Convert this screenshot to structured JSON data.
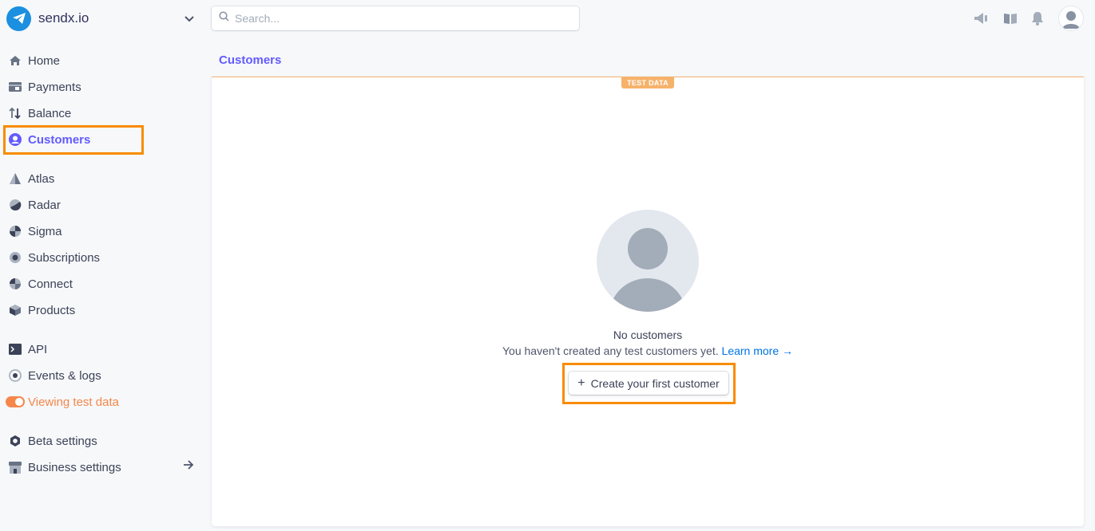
{
  "account": {
    "name": "sendx.io"
  },
  "search": {
    "placeholder": "Search..."
  },
  "sidebar": {
    "items": [
      {
        "label": "Home"
      },
      {
        "label": "Payments"
      },
      {
        "label": "Balance"
      },
      {
        "label": "Customers"
      },
      {
        "label": "Atlas"
      },
      {
        "label": "Radar"
      },
      {
        "label": "Sigma"
      },
      {
        "label": "Subscriptions"
      },
      {
        "label": "Connect"
      },
      {
        "label": "Products"
      },
      {
        "label": "API"
      },
      {
        "label": "Events & logs"
      },
      {
        "label": "Viewing test data"
      },
      {
        "label": "Beta settings"
      },
      {
        "label": "Business settings"
      }
    ]
  },
  "page": {
    "title": "Customers"
  },
  "card": {
    "badge": "TEST DATA",
    "empty_title": "No customers",
    "empty_desc": "You haven't created any test customers yet.",
    "learn_more": "Learn more →",
    "create_button": "Create your first customer"
  },
  "colors": {
    "accent": "#635bff",
    "test_mode": "#f5874b",
    "highlight": "#f98c00",
    "link": "#0073e6"
  },
  "icons": {
    "top_bar": [
      "megaphone-icon",
      "book-icon",
      "bell-icon",
      "user-avatar-icon"
    ]
  }
}
